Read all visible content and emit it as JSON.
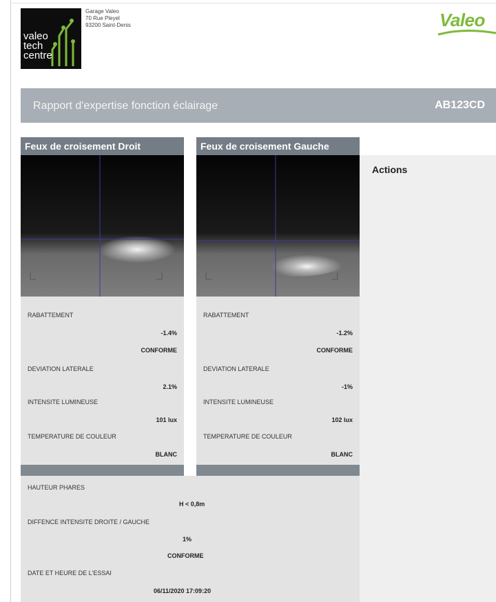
{
  "header": {
    "logo_lines": [
      "valeo",
      "tech",
      "centre"
    ],
    "address": [
      "Garage Valeo",
      "70 Rue Pleyel",
      "93200 Saint-Denis"
    ],
    "brand": "Valeo"
  },
  "title_bar": {
    "title": "Rapport d'expertise fonction éclairage",
    "plate": "AB123CD"
  },
  "columns": [
    {
      "header": "Feux de croisement Droit",
      "rabattement_label": "RABATTEMENT",
      "rabattement_value": "-1.4%",
      "rabattement_status": "CONFORME",
      "deviation_label": "DEVIATION LATERALE",
      "deviation_value": "2.1%",
      "intensite_label": "INTENSITE LUMINEUSE",
      "intensite_value": "101 lux",
      "temperature_label": "TEMPERATURE DE COULEUR",
      "temperature_value": "BLANC"
    },
    {
      "header": "Feux de croisement Gauche",
      "rabattement_label": "RABATTEMENT",
      "rabattement_value": "-1.2%",
      "rabattement_status": "CONFORME",
      "deviation_label": "DEVIATION LATERALE",
      "deviation_value": "-1%",
      "intensite_label": "INTENSITE LUMINEUSE",
      "intensite_value": "102 lux",
      "temperature_label": "TEMPERATURE DE COULEUR",
      "temperature_value": "BLANC"
    }
  ],
  "actions": {
    "label": "Actions"
  },
  "summary": {
    "hauteur_label": "HAUTEUR PHARES",
    "hauteur_value": "H < 0,8m",
    "difference_label": "DIFFENCE INTENSITE DROITE / GAUCHE",
    "difference_value": "1%",
    "difference_status": "CONFORME",
    "date_label": "DATE ET HEURE DE L'ESSAI",
    "date_value": "06/11/2020 17:09:20"
  },
  "colors": {
    "title_bar": "#a8aeb5",
    "column_header": "#747c86",
    "panel": "#e3e3e3",
    "brand_green": "#7dba3a"
  }
}
